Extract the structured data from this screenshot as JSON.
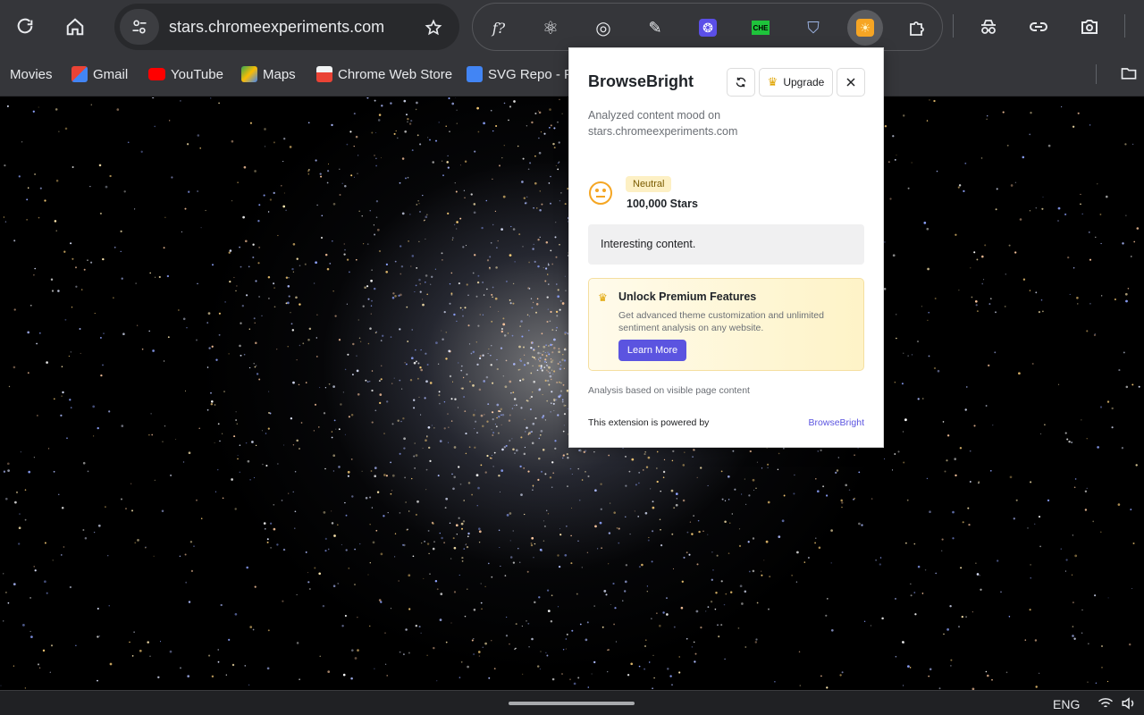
{
  "browser": {
    "url": "stars.chromeexperiments.com",
    "bookmarks": [
      {
        "label": "Movies",
        "color": "#35363a"
      },
      {
        "label": "Gmail",
        "color": "#ea4335"
      },
      {
        "label": "YouTube",
        "color": "#ff0000"
      },
      {
        "label": "Maps",
        "color": "#34a853"
      },
      {
        "label": "Chrome Web Store",
        "color": "#f1f3f4"
      },
      {
        "label": "SVG Repo - Fr",
        "color": "#4285f4"
      }
    ],
    "extensions": [
      {
        "icon": "function-icon",
        "glyph": "f?"
      },
      {
        "icon": "react-atom-icon",
        "glyph": "⚛"
      },
      {
        "icon": "target-icon",
        "glyph": "◎"
      },
      {
        "icon": "eyedropper-icon",
        "glyph": "✎"
      },
      {
        "icon": "purple-gear-icon",
        "glyph": "❂"
      },
      {
        "icon": "che-badge-icon",
        "glyph": "CHE"
      },
      {
        "icon": "shield-icon",
        "glyph": "⛉"
      },
      {
        "icon": "browsebright-sun-icon",
        "glyph": "☀"
      },
      {
        "icon": "puzzle-piece-icon",
        "glyph": "⧉"
      }
    ]
  },
  "taskbar": {
    "language": "ENG"
  },
  "popup": {
    "title": "BrowseBright",
    "upgrade_label": "Upgrade",
    "subtitle": "Analyzed content mood on stars.chromeexperiments.com",
    "mood_badge": "Neutral",
    "mood_value": "100,000 Stars",
    "summary": "Interesting content.",
    "premium": {
      "title": "Unlock Premium Features",
      "description": "Get advanced theme customization and unlimited sentiment analysis on any website.",
      "button": "Learn More"
    },
    "note": "Analysis based on visible page content",
    "powered_by": "This extension is powered by",
    "brand_link": "BrowseBright"
  },
  "colors": {
    "accent": "#5b54e0",
    "mood": "#f5a623",
    "badge_bg": "#fdf0c4"
  }
}
